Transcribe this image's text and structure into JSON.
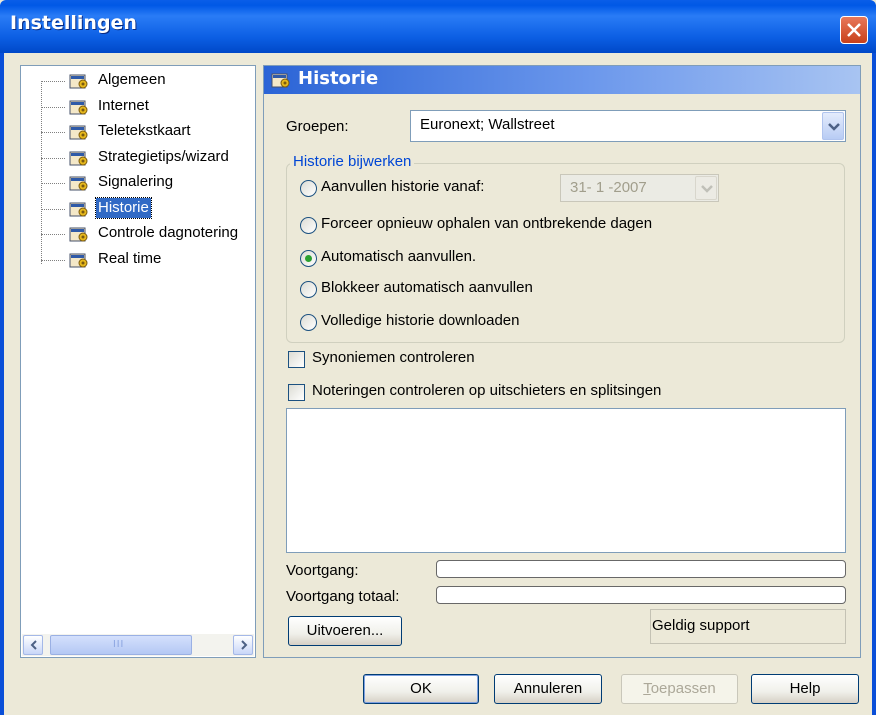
{
  "window": {
    "title": "Instellingen"
  },
  "tree": {
    "items": [
      {
        "label": "Algemeen"
      },
      {
        "label": "Internet"
      },
      {
        "label": "Teletekstkaart"
      },
      {
        "label": "Strategietips/wizard"
      },
      {
        "label": "Signalering"
      },
      {
        "label": "Historie",
        "selected": true
      },
      {
        "label": "Controle dagnotering"
      },
      {
        "label": "Real time"
      }
    ],
    "scroll_grip": "III"
  },
  "panel": {
    "title": "Historie",
    "groepen_label": "Groepen:",
    "groepen_value": "Euronext; Wallstreet",
    "group_title": "Historie bijwerken",
    "radios": [
      {
        "label": "Aanvullen historie vanaf:",
        "checked": false
      },
      {
        "label": "Forceer opnieuw ophalen van ontbrekende dagen",
        "checked": false
      },
      {
        "label": "Automatisch aanvullen.",
        "checked": true
      },
      {
        "label": "Blokkeer automatisch aanvullen",
        "checked": false
      },
      {
        "label": "Volledige historie downloaden",
        "checked": false
      }
    ],
    "date_value": "31- 1 -2007",
    "checkboxes": [
      {
        "label": "Synoniemen controleren",
        "checked": false
      },
      {
        "label": "Noteringen controleren op uitschieters en splitsingen",
        "checked": false
      }
    ],
    "voortgang_label": "Voortgang:",
    "voortgang_totaal_label": "Voortgang totaal:",
    "uitvoeren_label": "Uitvoeren...",
    "support_text": "Geldig support"
  },
  "buttons": {
    "ok": "OK",
    "annuleren": "Annuleren",
    "toepassen": "Toepassen",
    "help": "Help"
  },
  "colors": {
    "titlebar": "#0058e6",
    "selection": "#316ac5",
    "group_title": "#0046d5",
    "face": "#ece9d8"
  }
}
